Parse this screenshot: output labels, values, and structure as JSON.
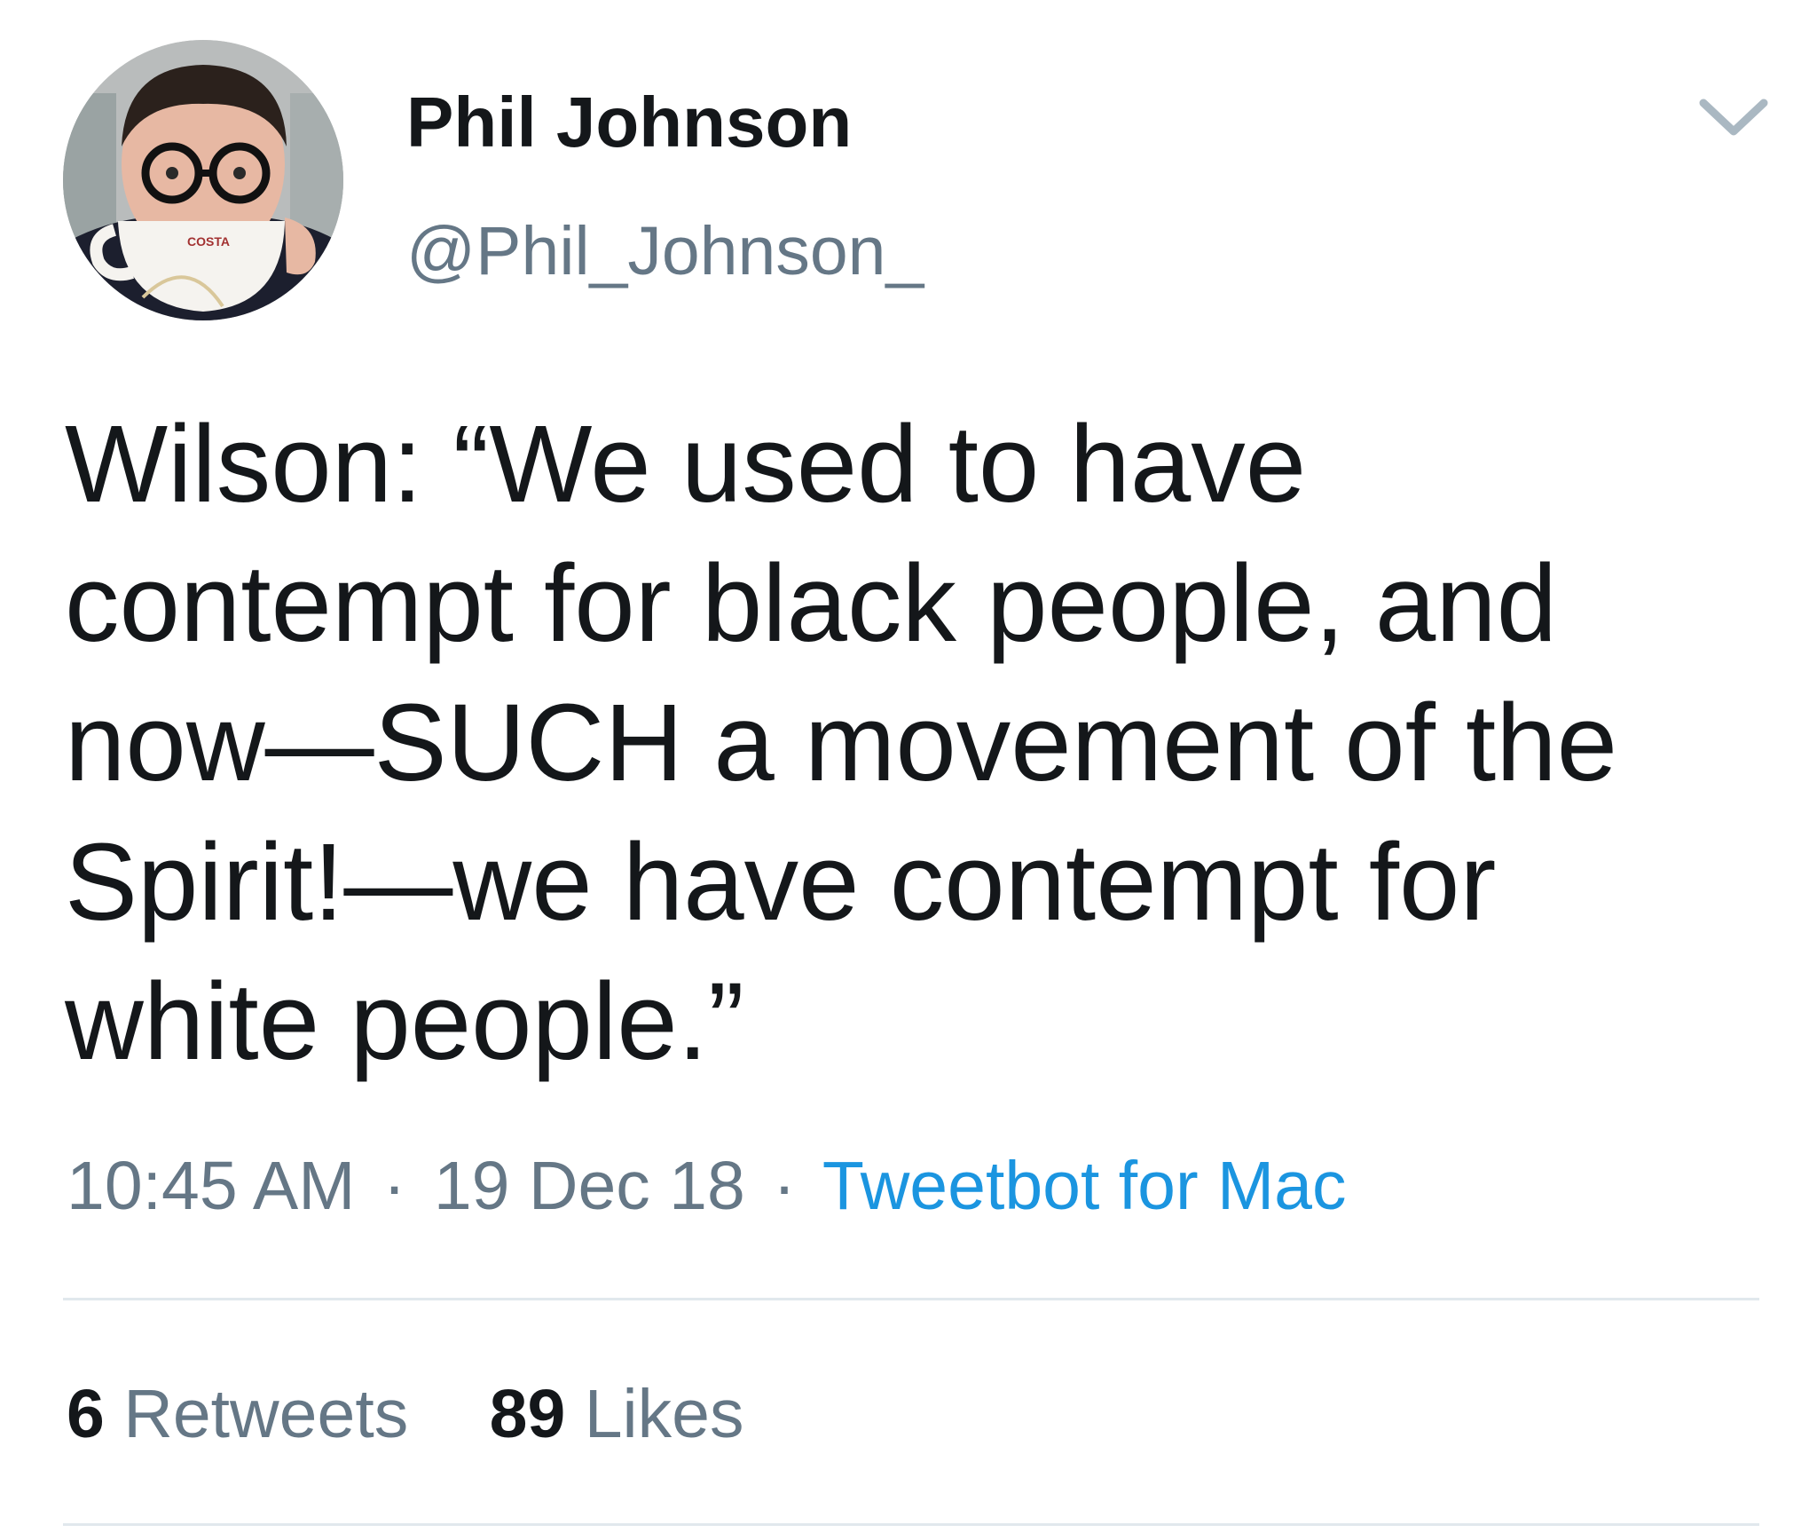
{
  "tweet": {
    "author": {
      "display_name": "Phil Johnson",
      "handle": "@Phil_Johnson_",
      "avatar_mug_text": "COSTA"
    },
    "text": "Wilson: “We used to have\ncontempt for black people, and\nnow—SUCH a movement of the\nSpirit!—we have contempt for\nwhite people.”",
    "time": "10:45 AM",
    "separator": "·",
    "date": "19 Dec 18",
    "source": "Tweetbot for Mac",
    "stats": {
      "retweets_count": "6",
      "retweets_label": "Retweets",
      "likes_count": "89",
      "likes_label": "Likes"
    },
    "menu_icon": "chevron-down-icon"
  },
  "colors": {
    "text_primary": "#14171a",
    "text_secondary": "#657786",
    "link": "#1b95e0",
    "divider": "#e1e8ed"
  }
}
